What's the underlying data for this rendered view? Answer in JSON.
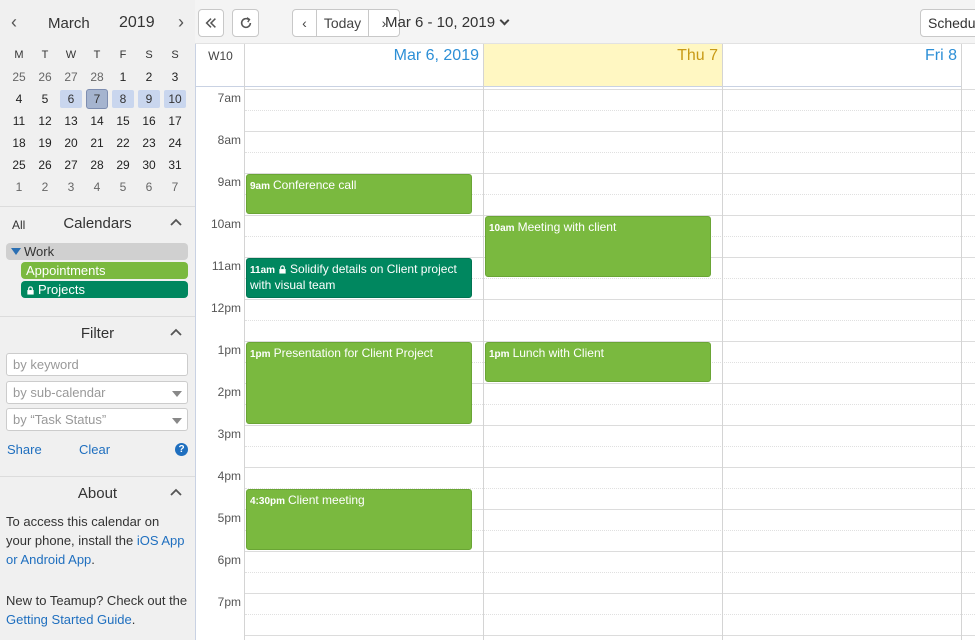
{
  "mini_calendar": {
    "month": "March",
    "year": "2019",
    "weekdays": [
      "M",
      "T",
      "W",
      "T",
      "F",
      "S",
      "S"
    ],
    "weeks": [
      [
        "25",
        "26",
        "27",
        "28",
        "1",
        "2",
        "3"
      ],
      [
        "4",
        "5",
        "6",
        "7",
        "8",
        "9",
        "10"
      ],
      [
        "11",
        "12",
        "13",
        "14",
        "15",
        "16",
        "17"
      ],
      [
        "18",
        "19",
        "20",
        "21",
        "22",
        "23",
        "24"
      ],
      [
        "25",
        "26",
        "27",
        "28",
        "29",
        "30",
        "31"
      ],
      [
        "1",
        "2",
        "3",
        "4",
        "5",
        "6",
        "7"
      ]
    ]
  },
  "calendars": {
    "all_label": "All",
    "title": "Calendars",
    "group": "Work",
    "items": [
      {
        "label": "Appointments",
        "color": "#7ab93f"
      },
      {
        "label": "Projects",
        "color": "#00875f",
        "locked": true
      }
    ]
  },
  "filter": {
    "title": "Filter",
    "keyword_placeholder": "by keyword",
    "subcalendar_placeholder": "by sub-calendar",
    "status_placeholder": "by “Task Status”",
    "share_label": "Share",
    "clear_label": "Clear",
    "help_icon": "?"
  },
  "about": {
    "title": "About",
    "line1_text": "To access this calendar on your phone, install the ",
    "line1_link": "iOS App or Android App",
    "line1_end": ".",
    "line2_text": "New to Teamup? Check out the ",
    "line2_link": "Getting Started Guide",
    "line2_end": "."
  },
  "toolbar": {
    "today_label": "Today",
    "date_range": "Mar 6 - 10, 2019",
    "scheduler_label": "Scheduler"
  },
  "grid": {
    "week_label": "W10",
    "days": [
      {
        "label": "Mar 6, 2019",
        "color": "#2d8fd6",
        "background": "#ffffff"
      },
      {
        "label": "Thu 7",
        "color": "#c89a16",
        "background": "#fff7c2"
      },
      {
        "label": "Fri 8",
        "color": "#2d8fd6",
        "background": "#ffffff"
      }
    ],
    "hours": [
      "7am",
      "8am",
      "9am",
      "10am",
      "11am",
      "12pm",
      "1pm",
      "2pm",
      "3pm",
      "4pm",
      "5pm",
      "6pm",
      "7pm"
    ]
  },
  "events": [
    {
      "time": "9am",
      "title": "Conference call",
      "day": 0,
      "start": 9,
      "end": 10,
      "calendar": "Appointments"
    },
    {
      "time": "11am",
      "title": "Solidify details on Client project with visual team",
      "day": 0,
      "start": 11,
      "end": 12,
      "calendar": "Projects",
      "locked": true
    },
    {
      "time": "1pm",
      "title": "Presentation for Client Project",
      "day": 0,
      "start": 13,
      "end": 15,
      "calendar": "Appointments"
    },
    {
      "time": "4:30pm",
      "title": "Client meeting",
      "day": 0,
      "start": 16.5,
      "end": 18,
      "calendar": "Appointments"
    },
    {
      "time": "10am",
      "title": "Meeting with client",
      "day": 1,
      "start": 10,
      "end": 11.5,
      "calendar": "Appointments"
    },
    {
      "time": "1pm",
      "title": "Lunch with Client",
      "day": 1,
      "start": 13,
      "end": 14,
      "calendar": "Appointments"
    }
  ]
}
